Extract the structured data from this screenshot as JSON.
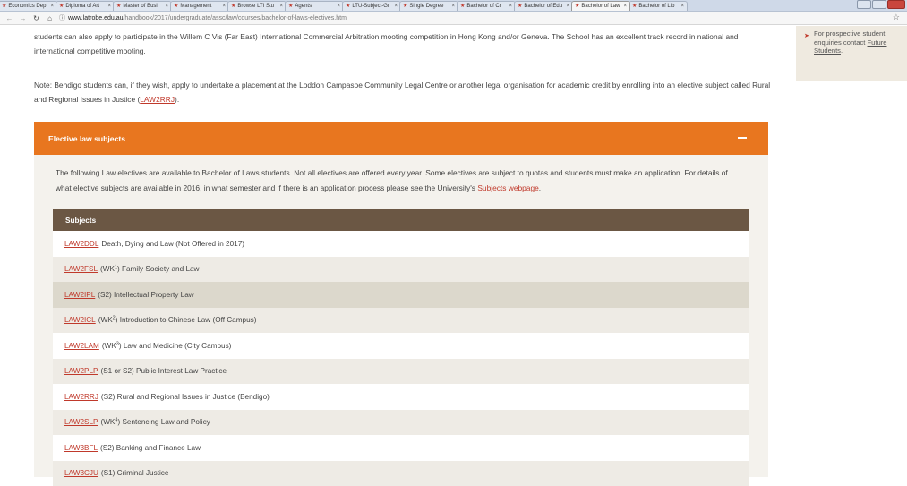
{
  "browser": {
    "tabs": [
      {
        "label": "Economics Dep"
      },
      {
        "label": "Diploma of Art"
      },
      {
        "label": "Master of Busi"
      },
      {
        "label": "Management"
      },
      {
        "label": "Browse LTI Stu"
      },
      {
        "label": "Agents"
      },
      {
        "label": "LTU-Subject-Gr"
      },
      {
        "label": "Single Degree"
      },
      {
        "label": "Bachelor of Cr"
      },
      {
        "label": "Bachelor of Edu"
      },
      {
        "label": "Bachelor of Law"
      },
      {
        "label": "Bachelor of Lib"
      }
    ],
    "url_host": "www.latrobe.edu.au",
    "url_path": "/handbook/2017/undergraduate/assc/law/courses/bachelor-of-laws-electives.htm"
  },
  "page": {
    "p1": "students can also apply to participate in the Willem C Vis (Far East) International Commercial Arbitration mooting competition in Hong Kong and/or Geneva. The School has an excellent track record in national and international competitive mooting.",
    "p2_before": "Note: Bendigo students can, if they wish, apply to undertake a placement at the Loddon Campaspe Community Legal Centre or another legal organisation for academic credit by enrolling into an elective subject called Rural and Regional Issues in Justice (",
    "p2_link": "LAW2RRJ",
    "p2_after": ")."
  },
  "accordion": {
    "title": "Elective law subjects",
    "intro_before": "The following Law electives are available to Bachelor of Laws students. Not all electives are offered every year. Some electives are subject to quotas and students must make an application. For details of what elective subjects are available in 2016, in what semester and if there is an application process please see the University's ",
    "intro_link": "Subjects webpage",
    "intro_after": ".",
    "table_header": "Subjects",
    "rows": [
      {
        "code": "LAW2DDL",
        "pre": "",
        "sup": "",
        "post": "Death, Dying and Law (Not Offered in 2017)"
      },
      {
        "code": "LAW2FSL",
        "pre": "(WK",
        "sup": "1",
        "post": ") Family Society and Law"
      },
      {
        "code": "LAW2IPL",
        "pre": "",
        "sup": "",
        "post": "(S2) Intellectual Property Law"
      },
      {
        "code": "LAW2ICL",
        "pre": "(WK",
        "sup": "2",
        "post": ") Introduction to Chinese Law (Off Campus)"
      },
      {
        "code": "LAW2LAM",
        "pre": "(WK",
        "sup": "3",
        "post": ") Law and Medicine (City Campus)"
      },
      {
        "code": "LAW2PLP",
        "pre": "",
        "sup": "",
        "post": "(S1 or S2) Public Interest Law Practice"
      },
      {
        "code": "LAW2RRJ",
        "pre": "",
        "sup": "",
        "post": "(S2) Rural and Regional Issues in Justice (Bendigo)"
      },
      {
        "code": "LAW2SLP",
        "pre": "(WK",
        "sup": "4",
        "post": ") Sentencing Law and Policy"
      },
      {
        "code": "LAW3BFL",
        "pre": "",
        "sup": "",
        "post": "(S2) Banking and Finance Law"
      },
      {
        "code": "LAW3CJU",
        "pre": "",
        "sup": "",
        "post": "(S1) Criminal Justice"
      }
    ]
  },
  "sidebar": {
    "text_before": "For prospective student enquiries contact ",
    "link": "Future Students",
    "text_after": "."
  },
  "colors": {
    "accent_orange": "#e8761f",
    "table_header_brown": "#6b5744",
    "link_red": "#c0392b"
  }
}
